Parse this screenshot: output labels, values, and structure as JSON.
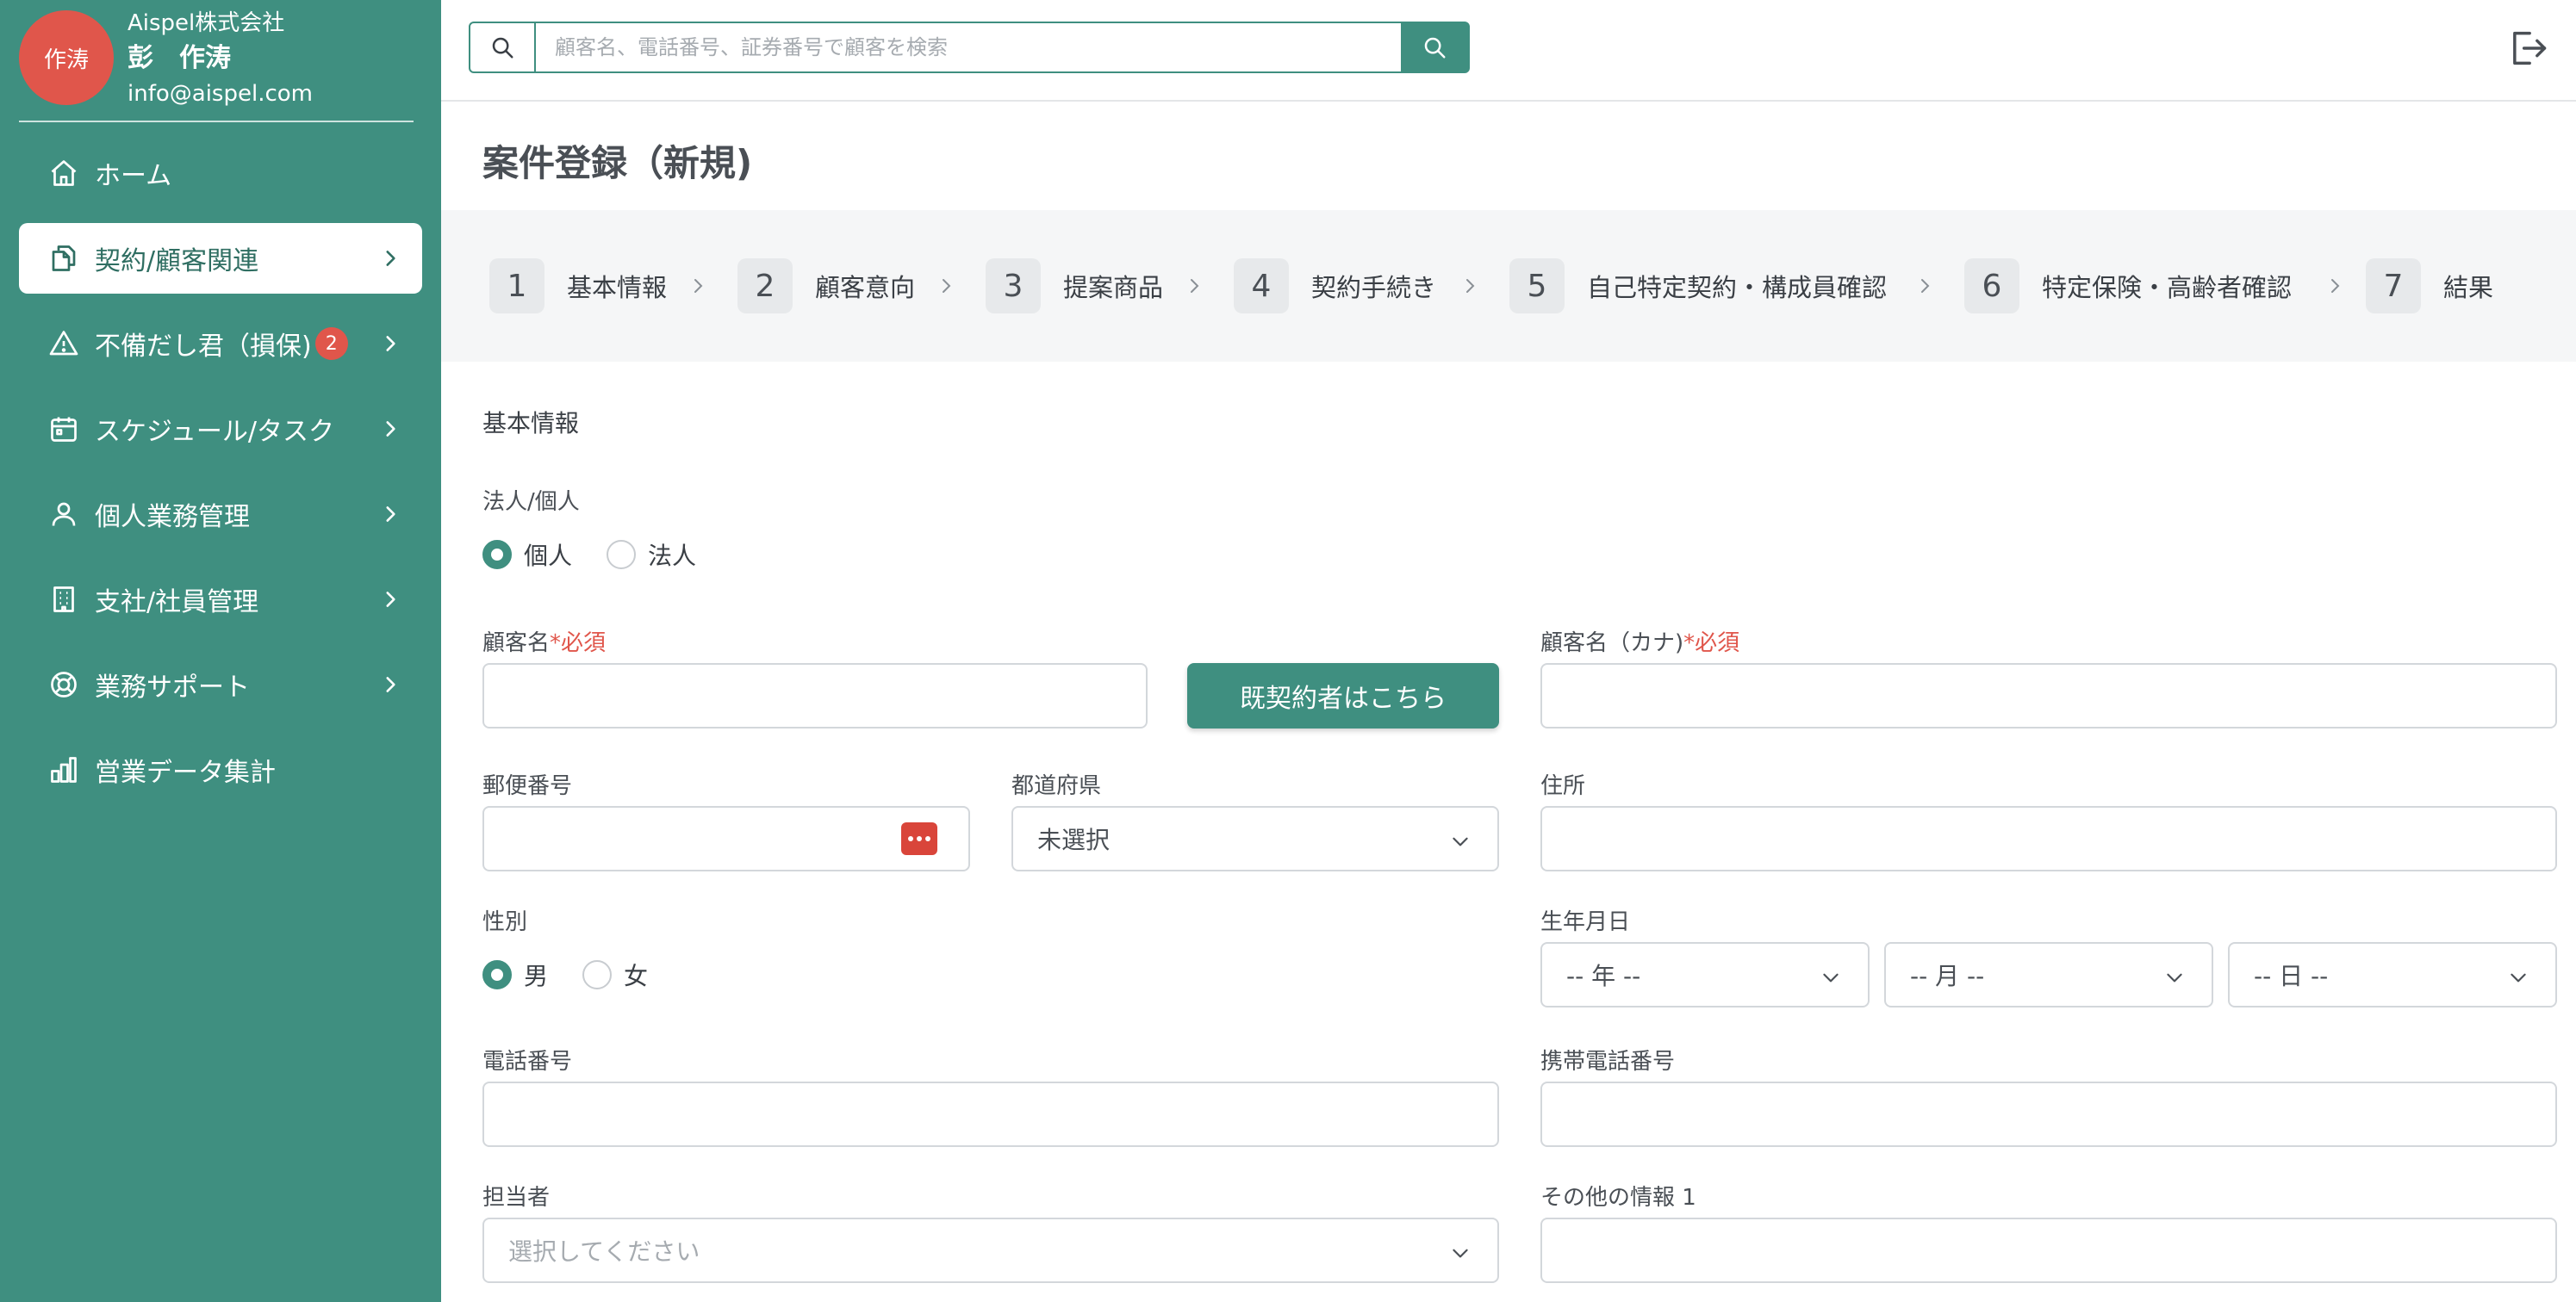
{
  "user": {
    "avatar_text": "作涛",
    "company": "Aispel株式会社",
    "name": "彭　作涛",
    "email": "info@aispel.com"
  },
  "nav": {
    "items": [
      {
        "label": "ホーム",
        "icon": "home-icon"
      },
      {
        "label": "契約/顧客関連",
        "icon": "documents-icon",
        "active": true
      },
      {
        "label": "不備だし君（損保)",
        "icon": "warning-icon",
        "badge": "2"
      },
      {
        "label": "スケジュール/タスク",
        "icon": "calendar-icon"
      },
      {
        "label": "個人業務管理",
        "icon": "user-icon"
      },
      {
        "label": "支社/社員管理",
        "icon": "building-icon"
      },
      {
        "label": "業務サポート",
        "icon": "lifebuoy-icon"
      },
      {
        "label": "営業データ集計",
        "icon": "bar-chart-icon"
      }
    ]
  },
  "search": {
    "placeholder": "顧客名、電話番号、証券番号で顧客を検索"
  },
  "page": {
    "title": "案件登録（新規)"
  },
  "steps": [
    {
      "num": "1",
      "label": "基本情報"
    },
    {
      "num": "2",
      "label": "顧客意向"
    },
    {
      "num": "3",
      "label": "提案商品"
    },
    {
      "num": "4",
      "label": "契約手続き"
    },
    {
      "num": "5",
      "label": "自己特定契約・構成員確認"
    },
    {
      "num": "6",
      "label": "特定保険・高齢者確認"
    },
    {
      "num": "7",
      "label": "結果"
    }
  ],
  "form": {
    "section_title": "基本情報",
    "entity_type": {
      "label": "法人/個人",
      "options": [
        "個人",
        "法人"
      ],
      "selected": "個人"
    },
    "customer_name": {
      "label": "顧客名",
      "required": "*必須",
      "value": ""
    },
    "existing_button": "既契約者はこちら",
    "customer_kana": {
      "label": "顧客名（カナ)",
      "required": "*必須",
      "value": ""
    },
    "postal_code": {
      "label": "郵便番号",
      "value": ""
    },
    "prefecture": {
      "label": "都道府県",
      "value": "未選択"
    },
    "address": {
      "label": "住所",
      "value": ""
    },
    "gender": {
      "label": "性別",
      "options": [
        "男",
        "女"
      ],
      "selected": "男"
    },
    "birthdate": {
      "label": "生年月日",
      "year": "-- 年 --",
      "month": "-- 月 --",
      "day": "-- 日 --"
    },
    "phone": {
      "label": "電話番号",
      "value": ""
    },
    "mobile": {
      "label": "携帯電話番号",
      "value": ""
    },
    "staff": {
      "label": "担当者",
      "placeholder": "選択してください"
    },
    "other_info": {
      "label": "その他の情報 1",
      "value": ""
    }
  },
  "colors": {
    "brand": "#3f8f80",
    "avatar": "#e0564b",
    "required": "#e0564b",
    "zip_lookup": "#d9453a"
  }
}
